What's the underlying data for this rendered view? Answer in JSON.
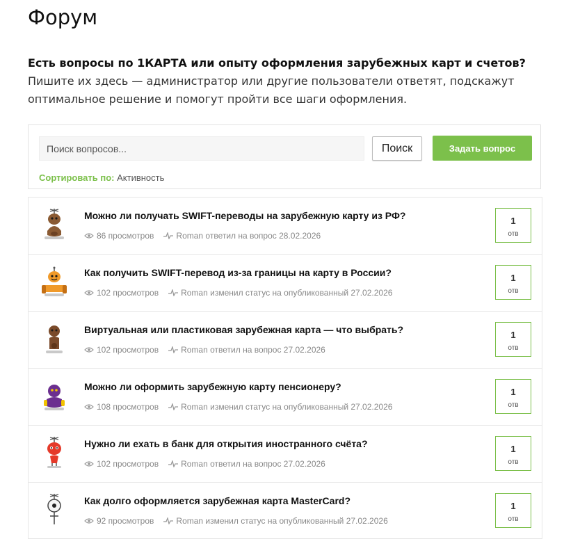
{
  "page": {
    "title": "Форум",
    "intro_bold": "Есть вопросы по 1КАРТА или опыту оформления зарубежных карт и счетов?",
    "intro_rest": " Пишите их здесь — администратор или другие пользователи ответят, подскажут оптимальное решение и помогут пройти все шаги оформления."
  },
  "search": {
    "placeholder": "Поиск вопросов...",
    "button_label": "Поиск",
    "ask_label": "Задать вопрос",
    "sort_label": "Сортировать по:",
    "sort_value": "Активность"
  },
  "colors": {
    "accent": "#7cc04b",
    "text": "#111111",
    "meta": "#888888"
  },
  "questions": [
    {
      "title": "Можно ли получать SWIFT-переводы на зарубежную карту из РФ?",
      "views": "86 просмотров",
      "activity": "Roman ответил на вопрос 28.02.2026",
      "answers": "1",
      "answers_label": "отв",
      "avatar": "robot-brown-antenna"
    },
    {
      "title": "Как получить SWIFT-перевод из-за границы на карту в России?",
      "views": "102 просмотров",
      "activity": "Roman изменил статус на опубликованный 27.02.2026",
      "answers": "1",
      "answers_label": "отв",
      "avatar": "robot-orange"
    },
    {
      "title": "Виртуальная или пластиковая зарубежная карта — что выбрать?",
      "views": "102 просмотров",
      "activity": "Roman ответил на вопрос 27.02.2026",
      "answers": "1",
      "answers_label": "отв",
      "avatar": "robot-brown"
    },
    {
      "title": "Можно ли оформить зарубежную карту пенсионеру?",
      "views": "108 просмотров",
      "activity": "Roman изменил статус на опубликованный 27.02.2026",
      "answers": "1",
      "answers_label": "отв",
      "avatar": "robot-purple"
    },
    {
      "title": "Нужно ли ехать в банк для открытия иностранного счёта?",
      "views": "102 просмотров",
      "activity": "Roman ответил на вопрос 27.02.2026",
      "answers": "1",
      "answers_label": "отв",
      "avatar": "robot-red-antenna"
    },
    {
      "title": "Как долго оформляется зарубежная карта MasterCard?",
      "views": "92 просмотров",
      "activity": "Roman изменил статус на опубликованный 27.02.2026",
      "answers": "1",
      "answers_label": "отв",
      "avatar": "robot-white-antenna"
    }
  ]
}
